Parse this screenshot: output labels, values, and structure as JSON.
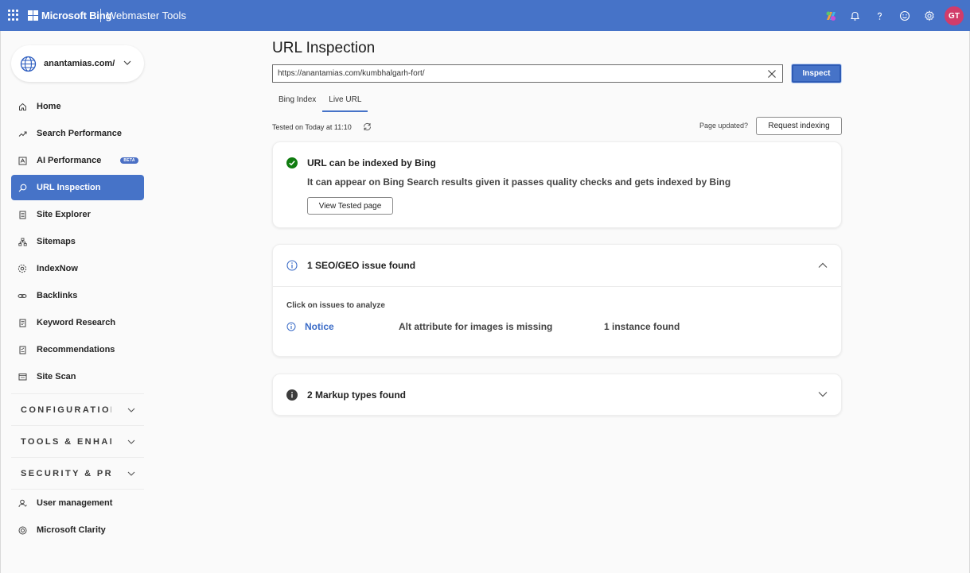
{
  "topbar": {
    "brand": "Microsoft Bing",
    "product": "Webmaster Tools",
    "avatar_initials": "GT",
    "accent": "#4673c8"
  },
  "sidebar": {
    "site": "anantamias.com/",
    "items": [
      {
        "label": "Home",
        "icon": "home-icon"
      },
      {
        "label": "Search Performance",
        "icon": "trend-icon"
      },
      {
        "label": "AI Performance",
        "icon": "ai-icon",
        "badge": "BETA"
      },
      {
        "label": "URL Inspection",
        "icon": "search-icon",
        "active": true
      },
      {
        "label": "Site Explorer",
        "icon": "document-icon"
      },
      {
        "label": "Sitemaps",
        "icon": "sitemap-icon"
      },
      {
        "label": "IndexNow",
        "icon": "gear-icon"
      },
      {
        "label": "Backlinks",
        "icon": "link-icon"
      },
      {
        "label": "Keyword Research",
        "icon": "document-icon"
      },
      {
        "label": "Recommendations",
        "icon": "checklist-icon"
      },
      {
        "label": "Site Scan",
        "icon": "scan-icon"
      }
    ],
    "sections": [
      {
        "label": "CONFIGURATION"
      },
      {
        "label": "TOOLS & ENHANCEMENTS"
      },
      {
        "label": "SECURITY & PRIVACY"
      }
    ],
    "bottom_items": [
      {
        "label": "User management",
        "icon": "user-icon"
      },
      {
        "label": "Microsoft Clarity",
        "icon": "clarity-icon"
      }
    ]
  },
  "main": {
    "title": "URL Inspection",
    "url_value": "https://anantamias.com/kumbhalgarh-fort/",
    "inspect_label": "Inspect",
    "tabs": [
      {
        "label": "Bing Index"
      },
      {
        "label": "Live URL",
        "active": true
      }
    ],
    "tested_text": "Tested on Today at 11:10",
    "page_updated": "Page updated?",
    "request_indexing": "Request indexing",
    "index_card": {
      "title": "URL can be indexed by Bing",
      "description": "It can appear on Bing Search results given it passes quality checks and gets indexed by Bing",
      "button": "View Tested page",
      "status_color": "#107c10"
    },
    "issues_card": {
      "title": "1 SEO/GEO issue found",
      "hint": "Click on issues to analyze",
      "issues": [
        {
          "severity": "Notice",
          "name": "Alt attribute for images is missing",
          "count": "1 instance found"
        }
      ]
    },
    "markup_card": {
      "title": "2 Markup types found"
    }
  }
}
